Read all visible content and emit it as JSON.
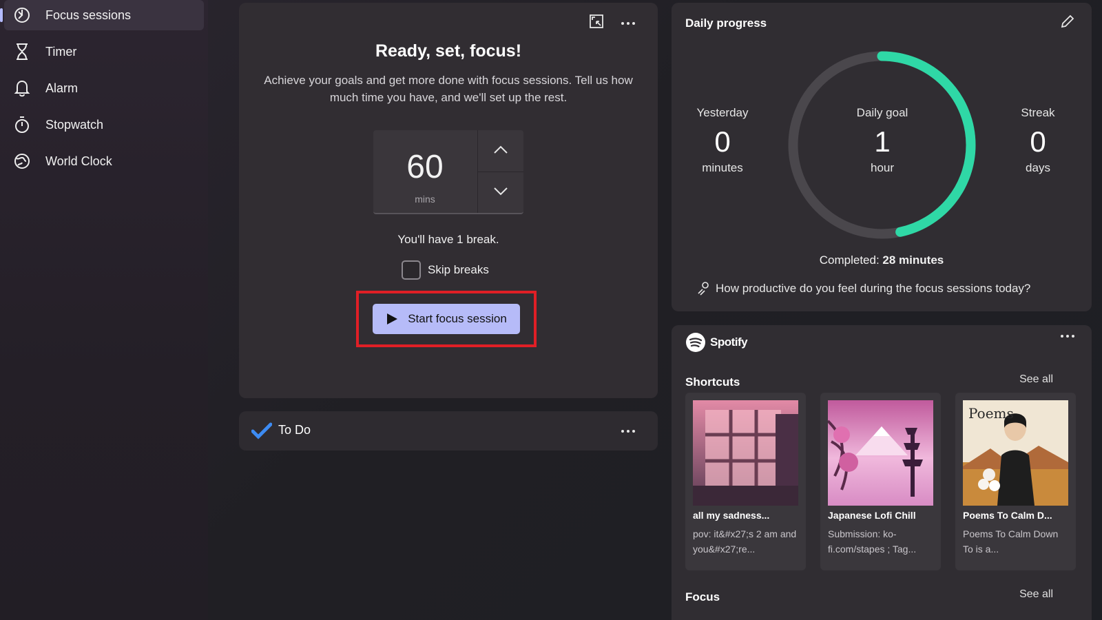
{
  "sidebar": {
    "items": [
      {
        "label": "Focus sessions",
        "icon": "focus-icon",
        "active": true
      },
      {
        "label": "Timer",
        "icon": "hourglass-icon"
      },
      {
        "label": "Alarm",
        "icon": "bell-icon"
      },
      {
        "label": "Stopwatch",
        "icon": "stopwatch-icon"
      },
      {
        "label": "World Clock",
        "icon": "globe-icon"
      }
    ]
  },
  "focus": {
    "title": "Ready, set, focus!",
    "description": "Achieve your goals and get more done with focus sessions. Tell us how much time you have, and we'll set up the rest.",
    "duration_value": "60",
    "duration_unit": "mins",
    "break_text": "You'll have 1 break.",
    "skip_breaks_label": "Skip breaks",
    "skip_breaks_checked": false,
    "start_button_label": "Start focus session"
  },
  "todo": {
    "label": "To Do"
  },
  "daily_progress": {
    "title": "Daily progress",
    "yesterday": {
      "label": "Yesterday",
      "value": "0",
      "unit": "minutes"
    },
    "goal": {
      "label": "Daily goal",
      "value": "1",
      "unit": "hour"
    },
    "streak": {
      "label": "Streak",
      "value": "0",
      "unit": "days"
    },
    "completed_prefix": "Completed:",
    "completed_value": "28 minutes",
    "progress_fraction": 0.4667,
    "feedback_prompt": "How productive do you feel during the focus sessions today?"
  },
  "spotify": {
    "brand": "Spotify",
    "shortcuts_title": "Shortcuts",
    "see_all": "See all",
    "focus_title": "Focus",
    "tiles": [
      {
        "title": "all my sadness...",
        "subtitle": "pov: it&#x27;s 2 am and you&#x27;re..."
      },
      {
        "title": "Japanese Lofi Chill",
        "subtitle": "Submission: ko-fi.com/stapes ; Tag..."
      },
      {
        "title": "Poems To Calm D...",
        "subtitle": "Poems To Calm Down To is a...",
        "art_text": "Poems"
      }
    ]
  },
  "colors": {
    "accent": "#b6bbf8",
    "ring_progress": "#2fd8a6",
    "ring_track": "#4a474c",
    "highlight": "#e01f26"
  }
}
